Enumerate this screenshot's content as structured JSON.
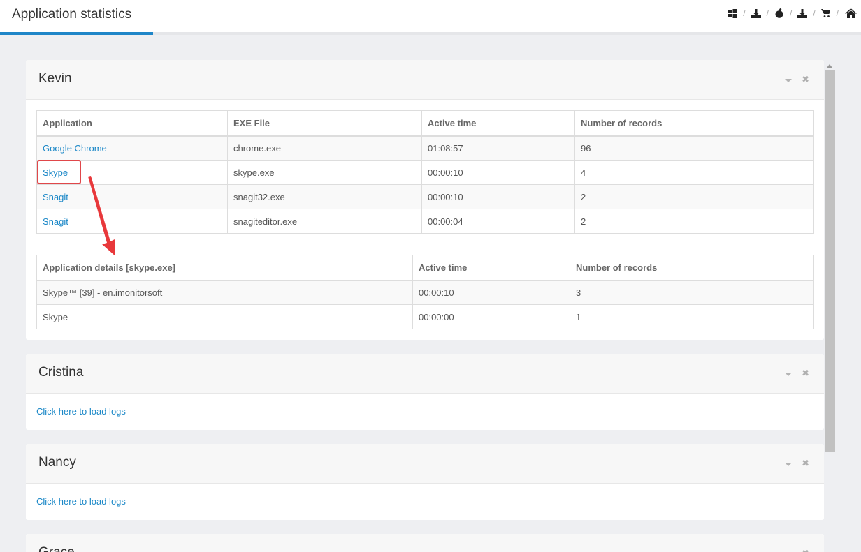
{
  "header": {
    "title": "Application statistics",
    "icons": [
      "windows-icon",
      "download-icon",
      "apple-icon",
      "download-icon",
      "cart-icon",
      "home-icon"
    ],
    "separator": "/"
  },
  "colors": {
    "accent": "#1f86c8",
    "link": "#1a87c7",
    "highlight": "#e0474a"
  },
  "panels": {
    "kevin": {
      "name": "Kevin",
      "apps_table": {
        "columns": [
          "Application",
          "EXE File",
          "Active time",
          "Number of records"
        ],
        "rows": [
          [
            "Google Chrome",
            "chrome.exe",
            "01:08:57",
            "96"
          ],
          [
            "Skype",
            "skype.exe",
            "00:00:10",
            "4"
          ],
          [
            "Snagit",
            "snagit32.exe",
            "00:00:10",
            "2"
          ],
          [
            "Snagit",
            "snagiteditor.exe",
            "00:00:04",
            "2"
          ]
        ]
      },
      "details_table": {
        "columns": [
          "Application details [skype.exe]",
          "Active time",
          "Number of records"
        ],
        "rows": [
          [
            "Skype™ [39] - en.imonitorsoft",
            "00:00:10",
            "3"
          ],
          [
            "Skype",
            "00:00:00",
            "1"
          ]
        ]
      }
    },
    "cristina": {
      "name": "Cristina",
      "load_link": "Click here to load logs"
    },
    "nancy": {
      "name": "Nancy",
      "load_link": "Click here to load logs"
    },
    "grace": {
      "name": "Grace"
    }
  }
}
